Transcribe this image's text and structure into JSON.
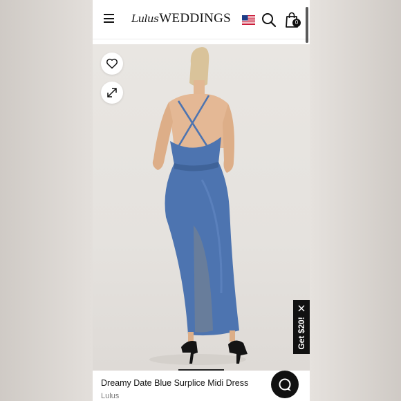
{
  "header": {
    "logo_script": "Lulus",
    "logo_main": "WEDDINGS",
    "cart_count": "0",
    "icons": [
      "hamburger-menu-icon",
      "us-flag-icon",
      "search-icon",
      "shopping-bag-icon"
    ]
  },
  "gallery": {
    "wishlist_icon": "heart-icon",
    "expand_icon": "expand-arrows-icon",
    "dress_color": "#4d74b0"
  },
  "promo": {
    "label": "Get $20!",
    "close_icon": "close-icon"
  },
  "product": {
    "title": "Dreamy Date Blue Surplice Midi Dress",
    "brand": "Lulus"
  },
  "chat": {
    "icon": "chat-bubble-icon"
  }
}
